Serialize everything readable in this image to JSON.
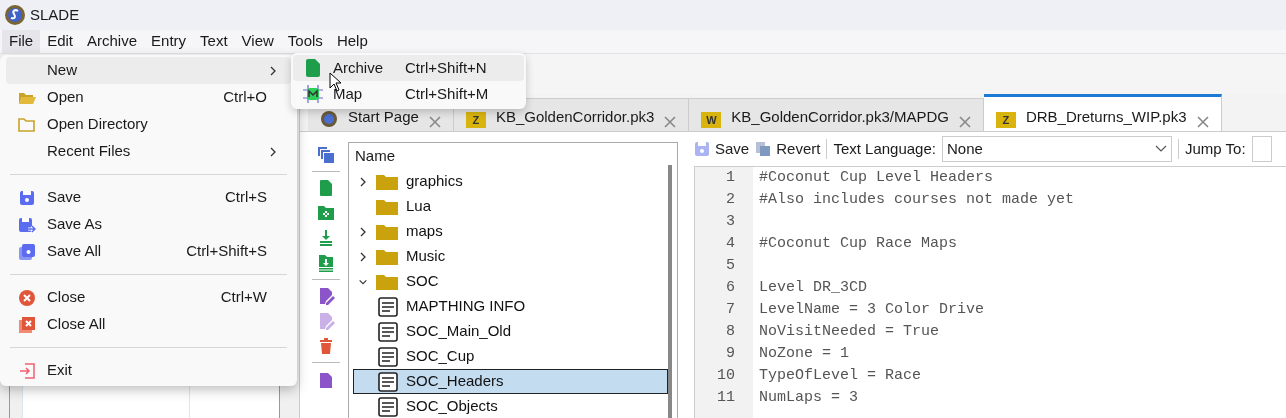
{
  "window": {
    "title": "SLADE"
  },
  "menubar": [
    {
      "label": "File",
      "selected": true
    },
    {
      "label": "Edit",
      "selected": false
    },
    {
      "label": "Archive",
      "selected": false
    },
    {
      "label": "Entry",
      "selected": false
    },
    {
      "label": "Text",
      "selected": false
    },
    {
      "label": "View",
      "selected": false
    },
    {
      "label": "Tools",
      "selected": false
    },
    {
      "label": "Help",
      "selected": false
    }
  ],
  "file_menu": [
    {
      "kind": "item",
      "label": "New",
      "submenu": true,
      "selected": true
    },
    {
      "kind": "item",
      "label": "Open",
      "shortcut": "Ctrl+O",
      "submenu": false,
      "selected": false
    },
    {
      "kind": "item",
      "label": "Open Directory",
      "submenu": false,
      "selected": false
    },
    {
      "kind": "item",
      "label": "Recent Files",
      "submenu": true,
      "selected": false
    },
    {
      "kind": "separator"
    },
    {
      "kind": "item",
      "label": "Save",
      "shortcut": "Ctrl+S",
      "submenu": false,
      "selected": false
    },
    {
      "kind": "item",
      "label": "Save As",
      "submenu": false,
      "selected": false
    },
    {
      "kind": "item",
      "label": "Save All",
      "shortcut": "Ctrl+Shift+S",
      "submenu": false,
      "selected": false
    },
    {
      "kind": "separator"
    },
    {
      "kind": "item",
      "label": "Close",
      "shortcut": "Ctrl+W",
      "submenu": false,
      "selected": false
    },
    {
      "kind": "item",
      "label": "Close All",
      "submenu": false,
      "selected": false
    },
    {
      "kind": "separator"
    },
    {
      "kind": "item",
      "label": "Exit",
      "submenu": false,
      "selected": false
    }
  ],
  "new_submenu": [
    {
      "label": "Archive",
      "shortcut": "Ctrl+Shift+N",
      "selected": true
    },
    {
      "label": "Map",
      "shortcut": "Ctrl+Shift+M",
      "selected": false
    }
  ],
  "tabs": [
    {
      "kind": "page",
      "label": "Start Page",
      "selected": false
    },
    {
      "kind": "archive",
      "badge": "Z",
      "label": "KB_GoldenCorridor.pk3",
      "selected": false
    },
    {
      "kind": "archive",
      "badge": "W",
      "label": "KB_GoldenCorridor.pk3/MAPDG",
      "selected": false
    },
    {
      "kind": "archive",
      "badge": "Z",
      "label": "DRB_Dreturns_WIP.pk3",
      "selected": true
    }
  ],
  "tree": {
    "header": "Name",
    "items": [
      {
        "kind": "folder",
        "label": "graphics",
        "expandable": true,
        "expanded": false,
        "selected": false
      },
      {
        "kind": "folder",
        "label": "Lua",
        "expandable": false,
        "selected": false
      },
      {
        "kind": "folder",
        "label": "maps",
        "expandable": true,
        "expanded": false,
        "selected": false
      },
      {
        "kind": "folder",
        "label": "Music",
        "expandable": true,
        "expanded": false,
        "selected": false
      },
      {
        "kind": "folder",
        "label": "SOC",
        "expandable": true,
        "expanded": true,
        "selected": false,
        "children": [
          {
            "kind": "text",
            "label": "MAPTHING INFO",
            "selected": false
          },
          {
            "kind": "text",
            "label": "SOC_Main_Old",
            "selected": false
          },
          {
            "kind": "text",
            "label": "SOC_Cup",
            "selected": false
          },
          {
            "kind": "text",
            "label": "SOC_Headers",
            "selected": true
          },
          {
            "kind": "text",
            "label": "SOC_Objects",
            "selected": false
          }
        ]
      }
    ]
  },
  "editor": {
    "save": "Save",
    "revert": "Revert",
    "language_label": "Text Language:",
    "language": "None",
    "jump_label": "Jump To:",
    "lines": [
      {
        "number": "1",
        "text": "#Coconut Cup Level Headers"
      },
      {
        "number": "2",
        "text": "#Also includes courses not made yet"
      },
      {
        "number": "3"
      },
      {
        "number": "4",
        "text": "#Coconut Cup Race Maps"
      },
      {
        "number": "5"
      },
      {
        "number": "6",
        "text": "Level DR_3CD"
      },
      {
        "number": "7",
        "text": "LevelName = 3 Color Drive"
      },
      {
        "number": "8",
        "text": "NoVisitNeeded = True"
      },
      {
        "number": "9",
        "text": "NoZone = 1"
      },
      {
        "number": "10",
        "text": "TypeOfLevel = Race"
      },
      {
        "number": "11",
        "text": "NumLaps = 3"
      }
    ]
  }
}
